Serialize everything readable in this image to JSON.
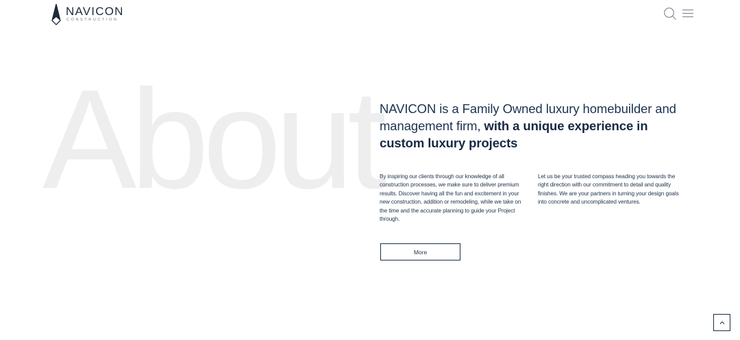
{
  "header": {
    "logo_name": "NAVICON",
    "logo_sub": "CONSTRUCTION",
    "icons": [
      "search-icon",
      "menu-icon"
    ]
  },
  "hero": {
    "bg_word": "About",
    "headline_regular": "NAVICON is a Family Owned luxury homebuilder and management firm, ",
    "headline_strong": "with a unique experience in custom luxury projects",
    "paragraph_left": "By inspiring our clients through our knowledge of all construction processes, we make sure to deliver premium results. Discover having all the fun and excitement in your new construction, addition or remodeling, while we take on the time and the accurate planning to guide your Project through.",
    "paragraph_right": "Let us be your trusted compass heading you towards the right direction with our commitment to detail and quality finishes. We are your partners in turning your design goals into concrete and uncomplicated ventures.",
    "more_label": "More"
  },
  "colors": {
    "text_navy": "#1b3350",
    "bg_word": "#eeeeee",
    "background": "#ffffff"
  }
}
